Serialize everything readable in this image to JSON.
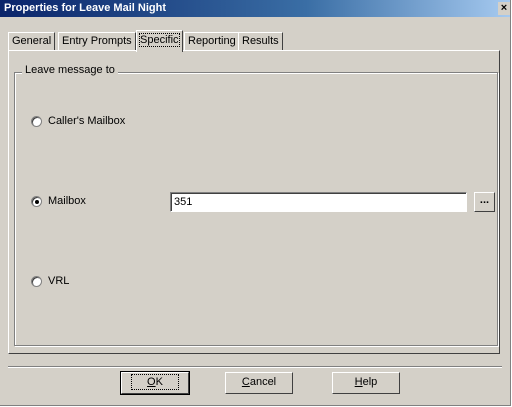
{
  "window": {
    "title": "Properties for Leave Mail Night",
    "close_glyph": "×"
  },
  "tabs": [
    {
      "label": "General"
    },
    {
      "label": "Entry Prompts"
    },
    {
      "label": "Specific",
      "active": true
    },
    {
      "label": "Reporting"
    },
    {
      "label": "Results"
    }
  ],
  "group": {
    "label": "Leave message to"
  },
  "options": {
    "callers_mailbox": {
      "label": "Caller's Mailbox",
      "checked": false
    },
    "mailbox": {
      "label": "Mailbox",
      "checked": true,
      "value": "351"
    },
    "vrl": {
      "label": "VRL",
      "checked": false
    }
  },
  "browse_button": {
    "label": "..."
  },
  "buttons": {
    "ok": {
      "mnemonic": "O",
      "rest": "K"
    },
    "cancel": {
      "mnemonic": "C",
      "rest": "ancel"
    },
    "help": {
      "mnemonic": "H",
      "rest": "elp"
    }
  }
}
